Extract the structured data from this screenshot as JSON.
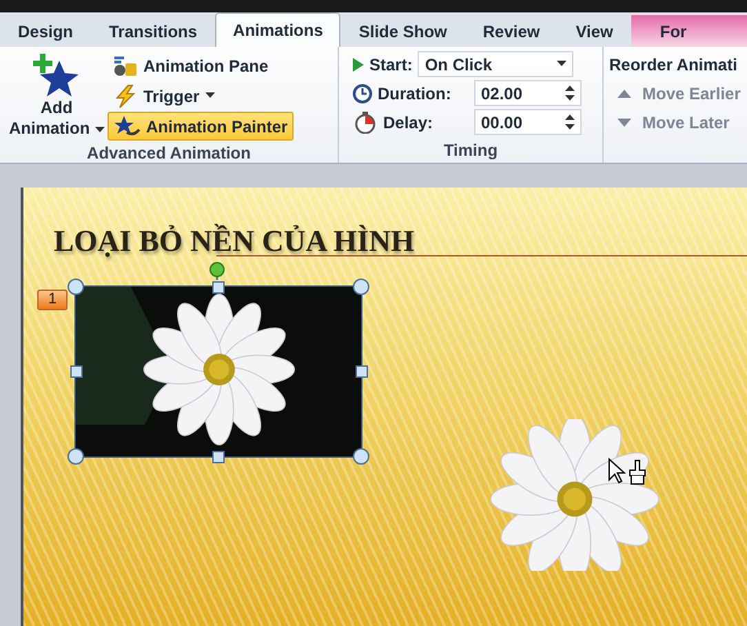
{
  "tabs": [
    {
      "label": "Design",
      "selected": false,
      "kind": "normal"
    },
    {
      "label": "Transitions",
      "selected": false,
      "kind": "normal"
    },
    {
      "label": "Animations",
      "selected": true,
      "kind": "normal"
    },
    {
      "label": "Slide Show",
      "selected": false,
      "kind": "normal"
    },
    {
      "label": "Review",
      "selected": false,
      "kind": "normal"
    },
    {
      "label": "View",
      "selected": false,
      "kind": "normal"
    },
    {
      "label": "For",
      "selected": false,
      "kind": "contextual"
    }
  ],
  "advanced_animation": {
    "add_animation": "Add Animation",
    "animation_pane": "Animation Pane",
    "trigger": "Trigger",
    "painter": {
      "label": "Animation Painter",
      "selected": true
    },
    "group_label": "Advanced Animation"
  },
  "timing": {
    "start": {
      "label": "Start:",
      "value": "On Click"
    },
    "duration": {
      "label": "Duration:",
      "value": "02.00"
    },
    "delay": {
      "label": "Delay:",
      "value": "00.00"
    },
    "group_label": "Timing"
  },
  "reorder": {
    "title": "Reorder Animati",
    "move_earlier": {
      "label": "Move Earlier",
      "disabled": true
    },
    "move_later": {
      "label": "Move Later",
      "disabled": true
    }
  },
  "slide": {
    "title": "LOẠI BỎ NỀN CỦA HÌNH",
    "animation_badge": "1",
    "picture": {
      "selected": true
    }
  }
}
